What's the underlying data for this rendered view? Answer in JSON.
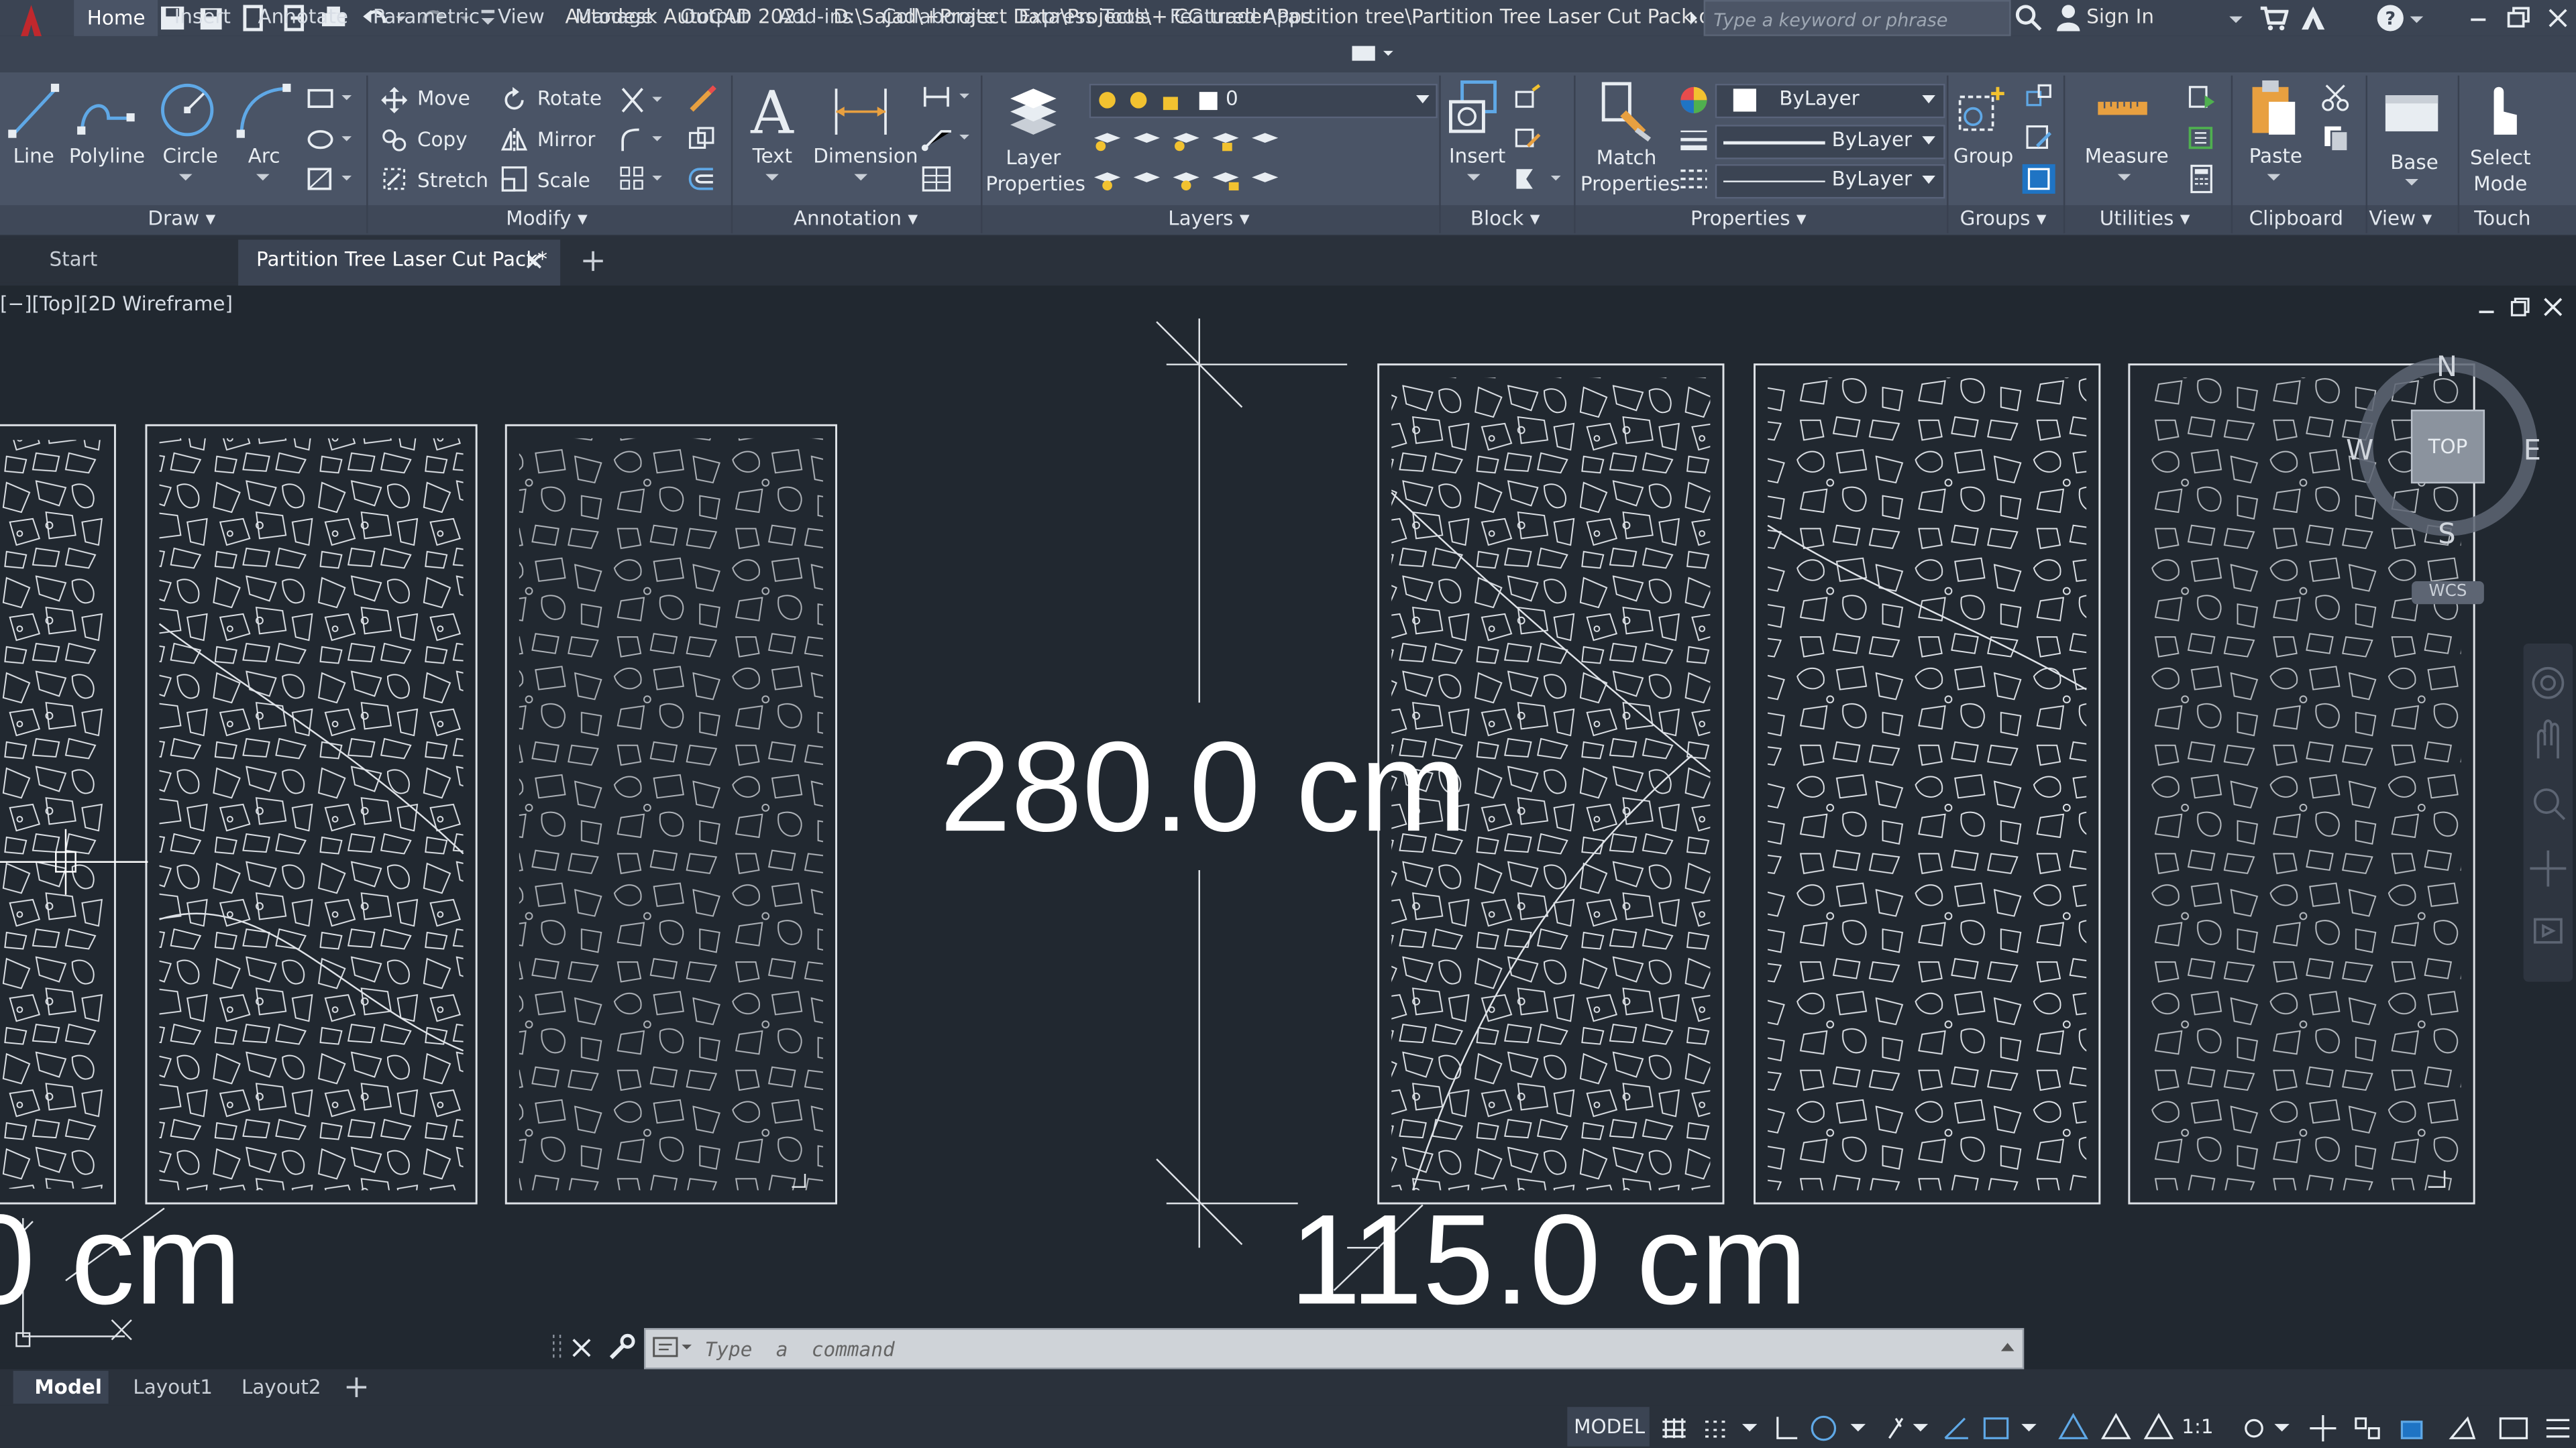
{
  "app": {
    "title": "Autodesk AutoCAD 2021",
    "file_path": "D:\\Sajad\\+Project Data\\Projects\\+ CG trader\\Partition tree\\Partition Tree Laser Cut Pack.dwg",
    "search_placeholder": "Type a keyword or phrase",
    "sign_in": "Sign In",
    "logo_letter": "A"
  },
  "ribbon_tabs": [
    "Home",
    "Insert",
    "Annotate",
    "Parametric",
    "View",
    "Manage",
    "Output",
    "Add-ins",
    "Collaborate",
    "Express Tools",
    "Featured Apps"
  ],
  "draw": {
    "line": "Line",
    "polyline": "Polyline",
    "circle": "Circle",
    "arc": "Arc",
    "title": "Draw"
  },
  "modify": {
    "move": "Move",
    "rotate": "Rotate",
    "copy": "Copy",
    "mirror": "Mirror",
    "stretch": "Stretch",
    "scale": "Scale",
    "title": "Modify"
  },
  "annotation": {
    "text": "Text",
    "dimension": "Dimension",
    "title": "Annotation"
  },
  "layers": {
    "layer_properties": "Layer Properties",
    "current_layer": "0",
    "title": "Layers"
  },
  "block": {
    "insert": "Insert",
    "title": "Block"
  },
  "properties": {
    "match": "Match Properties",
    "color": "ByLayer",
    "linetype": "ByLayer",
    "lineweight": "ByLayer",
    "title": "Properties"
  },
  "groups": {
    "group": "Group",
    "title": "Groups"
  },
  "utilities": {
    "measure": "Measure",
    "title": "Utilities"
  },
  "clipboard": {
    "paste": "Paste",
    "title": "Clipboard"
  },
  "view_panel": {
    "base": "Base",
    "title": "View"
  },
  "touch": {
    "select_mode": "Select Mode",
    "title": "Touch"
  },
  "file_tabs": {
    "start": "Start",
    "active": "Partition Tree Laser Cut Pack*"
  },
  "viewport": {
    "label": "[−][Top][2D Wireframe]",
    "dim_height": "280.0 cm",
    "dim_width": "115.0 cm",
    "dim_partial": "0 cm",
    "compass": {
      "n": "N",
      "s": "S",
      "e": "E",
      "w": "W",
      "top": "TOP",
      "wcs": "WCS"
    }
  },
  "command": {
    "placeholder": "Type  a  command"
  },
  "layout_tabs": [
    "Model",
    "Layout1",
    "Layout2"
  ],
  "status": {
    "model": "MODEL",
    "scale": "1:1"
  },
  "colors": {
    "background": "#212830",
    "ribbon": "#4a5466",
    "titlebar": "#3b4453",
    "accent_red": "#c0282d",
    "accent_blue": "#1f74c4"
  }
}
